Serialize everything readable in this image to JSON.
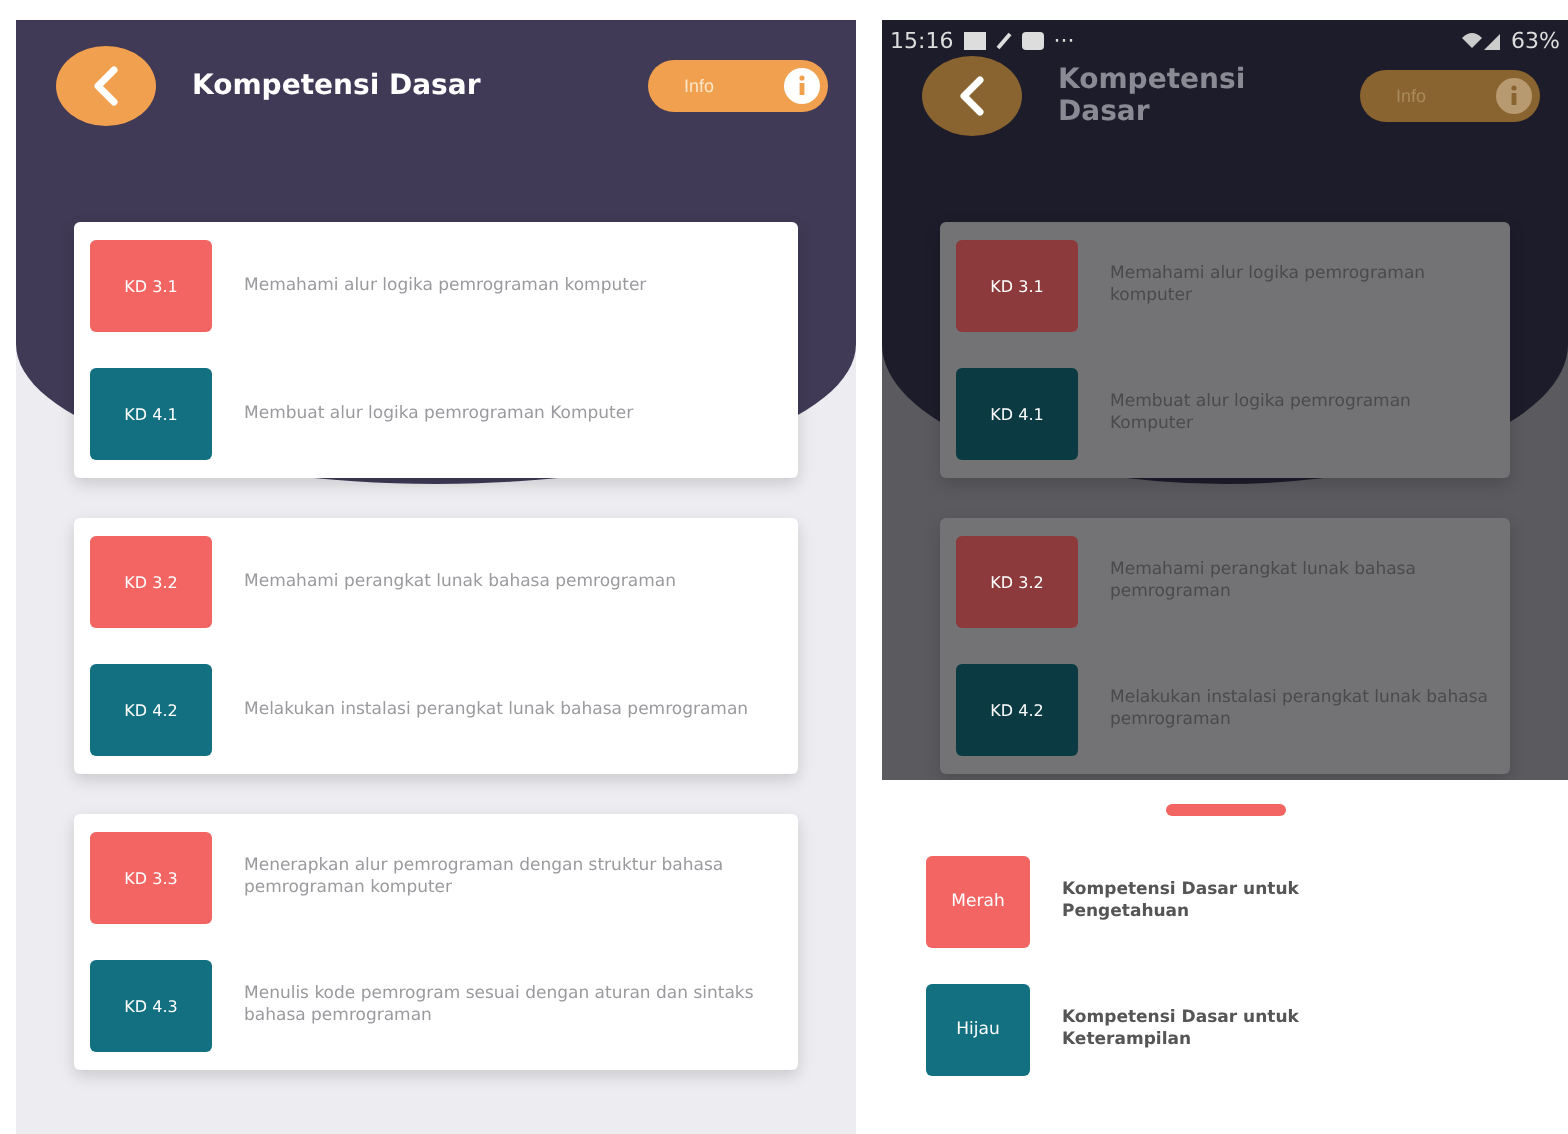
{
  "main_screen": {
    "title": "Kompetensi Dasar",
    "info_button": "Info",
    "groups": [
      {
        "items": [
          {
            "kind": "knowledge",
            "code": "KD 3.1",
            "text": "Memahami alur logika pemrograman komputer"
          },
          {
            "kind": "skill",
            "code": "KD 4.1",
            "text": "Membuat alur logika pemrograman Komputer"
          }
        ]
      },
      {
        "items": [
          {
            "kind": "knowledge",
            "code": "KD 3.2",
            "text": "Memahami perangkat lunak bahasa pemrograman"
          },
          {
            "kind": "skill",
            "code": "KD 4.2",
            "text": "Melakukan instalasi perangkat lunak bahasa pemrograman"
          }
        ]
      },
      {
        "items": [
          {
            "kind": "knowledge",
            "code": "KD 3.3",
            "text": "Menerapkan alur pemrograman dengan struktur bahasa pemrograman komputer"
          },
          {
            "kind": "skill",
            "code": "KD 4.3",
            "text": "Menulis kode pemrogram sesuai dengan aturan dan sintaks bahasa pemrograman"
          }
        ]
      }
    ]
  },
  "legend_screen": {
    "status_bar": {
      "time": "15:16",
      "more": "···",
      "battery": "63%"
    },
    "title": "Kompetensi Dasar",
    "info_button": "Info",
    "groups": [
      {
        "items": [
          {
            "kind": "knowledge",
            "code": "KD 3.1",
            "text": "Memahami alur logika pemrograman komputer"
          },
          {
            "kind": "skill",
            "code": "KD 4.1",
            "text": "Membuat alur logika pemrograman Komputer"
          }
        ]
      },
      {
        "items": [
          {
            "kind": "knowledge",
            "code": "KD 3.2",
            "text": "Memahami perangkat lunak bahasa pemrograman"
          },
          {
            "kind": "skill",
            "code": "KD 4.2",
            "text": "Melakukan instalasi perangkat lunak bahasa pemrograman"
          }
        ]
      }
    ],
    "legend": [
      {
        "kind": "knowledge",
        "label": "Merah",
        "text": "Kompetensi Dasar untuk Pengetahuan"
      },
      {
        "kind": "skill",
        "label": "Hijau",
        "text": "Kompetensi Dasar untuk Keterampilan"
      }
    ]
  }
}
